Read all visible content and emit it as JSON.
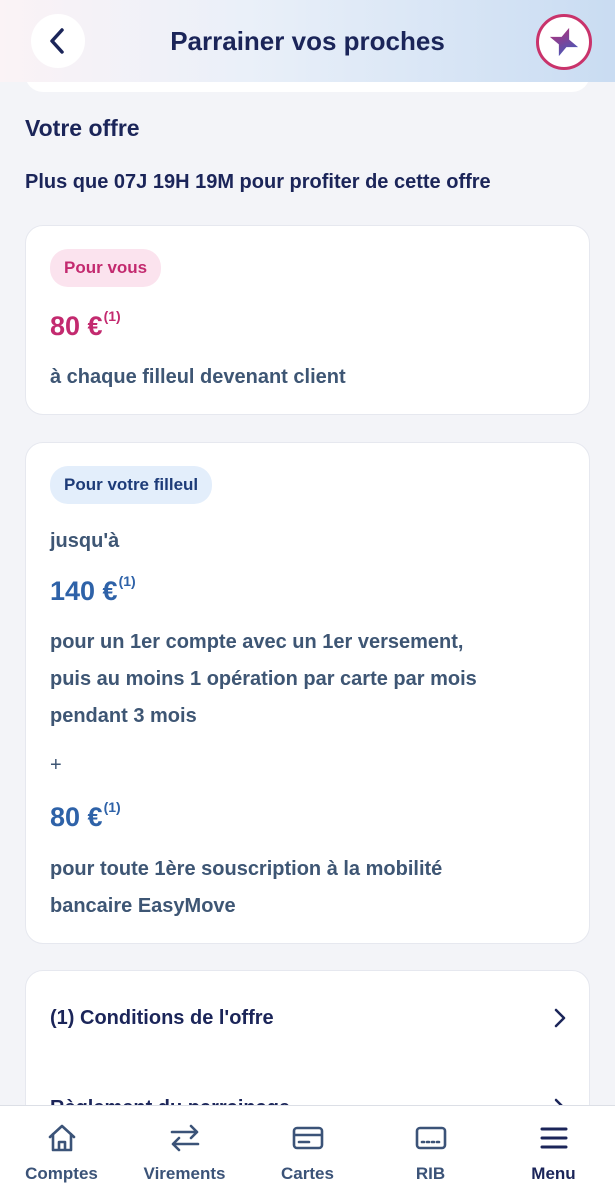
{
  "header": {
    "title": "Parrainer vos proches"
  },
  "offer": {
    "section_title": "Votre offre",
    "countdown": "Plus que 07J 19H 19M pour profiter de cette offre",
    "for_you": {
      "badge": "Pour vous",
      "amount": "80 €",
      "note": "(1)",
      "description": "à chaque filleul devenant client"
    },
    "for_referee": {
      "badge": "Pour votre filleul",
      "prefix": "jusqu'à",
      "amount1": "140 €",
      "note1": "(1)",
      "line1": "pour un 1er compte avec un 1er versement,",
      "line2": "puis au moins 1 opération par carte par mois",
      "line3": "pendant 3 mois",
      "plus": "+",
      "amount2": "80 €",
      "note2": "(1)",
      "line4": "pour toute 1ère souscription à la mobilité",
      "line5": "bancaire EasyMove"
    }
  },
  "links": [
    {
      "label": "(1) Conditions de l'offre"
    },
    {
      "label": "Règlement du parrainage"
    }
  ],
  "bottom_nav": {
    "items": [
      {
        "label": "Comptes",
        "icon": "home-icon"
      },
      {
        "label": "Virements",
        "icon": "transfer-icon"
      },
      {
        "label": "Cartes",
        "icon": "card-icon"
      },
      {
        "label": "RIB",
        "icon": "rib-icon"
      },
      {
        "label": "Menu",
        "icon": "menu-icon"
      }
    ]
  },
  "colors": {
    "primary": "#1b2559",
    "pink": "#c32a6f",
    "blue": "#2e62a8"
  }
}
